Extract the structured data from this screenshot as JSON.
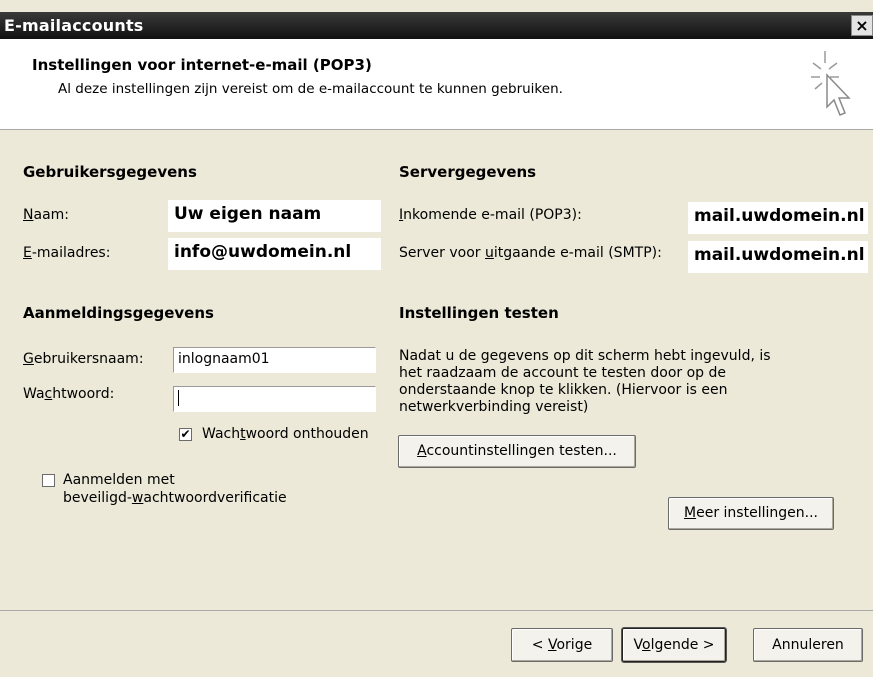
{
  "window": {
    "title": "E-mailaccounts",
    "close_label": "×"
  },
  "header": {
    "title": "Instellingen voor internet-e-mail (POP3)",
    "subtitle": "Al deze instellingen zijn vereist om de e-mailaccount te kunnen gebruiken."
  },
  "user": {
    "section_title": "Gebruikersgegevens",
    "name_label": "Naam:",
    "name_value": "Uw eigen naam",
    "email_label": "E-mailadres:",
    "email_value": "info@uwdomein.nl"
  },
  "server": {
    "section_title": "Servergegevens",
    "incoming_label": "Inkomende e-mail (POP3):",
    "incoming_value": "mail.uwdomein.nl",
    "outgoing_label": "Server voor uitgaande e-mail (SMTP):",
    "outgoing_value": "mail.uwdomein.nl"
  },
  "login": {
    "section_title": "Aanmeldingsgegevens",
    "username_label": "Gebruikersnaam:",
    "username_value": "inlognaam01",
    "password_label": "Wachtwoord:",
    "password_value": "",
    "remember_label": "Wachtwoord onthouden",
    "remember_checked": true,
    "spa_label_line1": "Aanmelden met",
    "spa_label_line2": "beveiligd-wachtwoordverificatie",
    "spa_checked": false
  },
  "test": {
    "section_title": "Instellingen testen",
    "description": "Nadat u de gegevens op dit scherm hebt ingevuld, is het raadzaam de account te testen door op de onderstaande knop te klikken. (Hiervoor is een netwerkverbinding vereist)",
    "test_button": "Accountinstellingen testen...",
    "more_button": "Meer instellingen..."
  },
  "footer": {
    "back_button": "< Vorige",
    "next_button": "Volgende >",
    "cancel_button": "Annuleren"
  },
  "icons": {
    "wizard": "cursor-sparkle-icon",
    "check": "check-icon"
  }
}
